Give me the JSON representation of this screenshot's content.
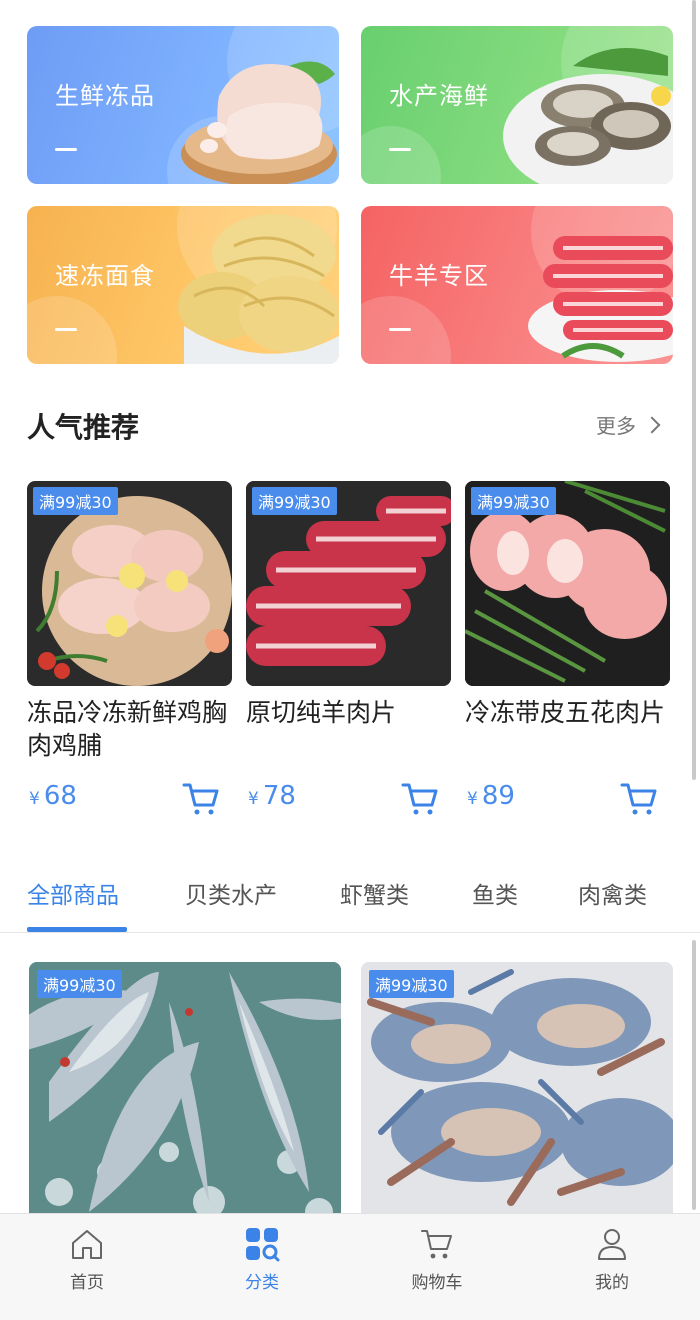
{
  "categories": [
    {
      "title": "生鲜冻品",
      "color": "#6e9cf5",
      "icon": "chicken-leg"
    },
    {
      "title": "水产海鲜",
      "color": "#68cf6f",
      "icon": "oysters"
    },
    {
      "title": "速冻面食",
      "color": "#f7b24f",
      "icon": "noodles"
    },
    {
      "title": "牛羊专区",
      "color": "#f56363",
      "icon": "meat-rolls"
    }
  ],
  "recommend": {
    "title": "人气推荐",
    "more": "更多",
    "products": [
      {
        "tag": "满99减30",
        "name": "冻品冷冻新鲜鸡胸肉鸡脯",
        "currency": "¥",
        "price": "68",
        "icon": "chicken-breast"
      },
      {
        "tag": "满99减30",
        "name": "原切纯羊肉片",
        "currency": "¥",
        "price": "78",
        "icon": "lamb-slices"
      },
      {
        "tag": "满99减30",
        "name": "冷冻带皮五花肉片",
        "currency": "¥",
        "price": "89",
        "icon": "pork-slices"
      }
    ]
  },
  "tabs": [
    "全部商品",
    "贝类水产",
    "虾蟹类",
    "鱼类",
    "肉禽类"
  ],
  "active_tab": "全部商品",
  "list": [
    {
      "tag": "满99减30",
      "icon": "fish-on-ice"
    },
    {
      "tag": "满99减30",
      "icon": "crabs"
    }
  ],
  "nav": [
    {
      "label": "首页",
      "icon": "home-icon"
    },
    {
      "label": "分类",
      "icon": "category-icon",
      "active": true
    },
    {
      "label": "购物车",
      "icon": "cart-icon"
    },
    {
      "label": "我的",
      "icon": "user-icon"
    }
  ],
  "colors": {
    "accent": "#3b83e6",
    "tag": "#4a8cec"
  }
}
